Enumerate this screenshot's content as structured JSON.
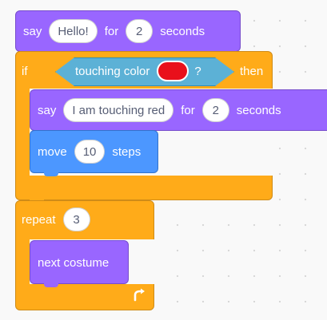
{
  "say_block_1": {
    "label_say": "say",
    "message": "Hello!",
    "label_for": "for",
    "secs": "2",
    "label_seconds": "seconds"
  },
  "if_block": {
    "label_if": "if",
    "condition": {
      "label": "touching color",
      "color": "#e9101b",
      "qmark": "?"
    },
    "label_then": "then"
  },
  "say_block_2": {
    "label_say": "say",
    "message": "I am touching red",
    "label_for": "for",
    "secs": "2",
    "label_seconds": "seconds"
  },
  "move_block": {
    "label_move": "move",
    "steps": "10",
    "label_steps": "steps"
  },
  "repeat_block": {
    "label_repeat": "repeat",
    "times": "3",
    "arrow_icon": "repeat-arrow-icon"
  },
  "next_costume_block": {
    "label": "next costume"
  },
  "colors": {
    "looks": "#9966ff",
    "motion": "#4c97ff",
    "control": "#ffab19",
    "sensing": "#5cb1d6"
  }
}
